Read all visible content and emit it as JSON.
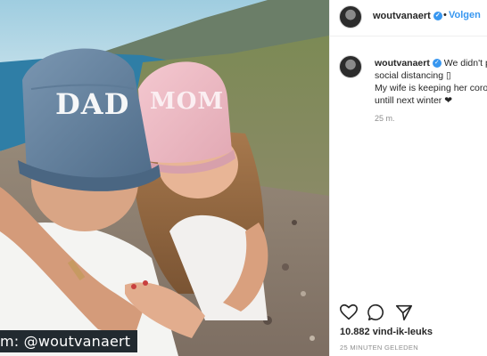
{
  "post": {
    "username": "woutvanaert",
    "follow_label": "Volgen",
    "separator": "•",
    "caption_lines": [
      "We didn't p",
      "social distancing ▯",
      "My wife is keeping her coro",
      "untill next winter ❤"
    ],
    "time": "25 m.",
    "likes": "10.882 vind-ik-leuks",
    "time_ago": "25 MINUTEN GELEDEN"
  },
  "photo": {
    "cap_left_text": "DAD",
    "cap_right_text": "MOM",
    "watermark": "m: @woutvanaert"
  },
  "icons": {
    "like": "heart-icon",
    "comment": "comment-icon",
    "share": "share-icon",
    "verified": "verified-badge-icon"
  },
  "colors": {
    "accent": "#3897f0",
    "text": "#262626",
    "muted": "#8e8e8e"
  }
}
